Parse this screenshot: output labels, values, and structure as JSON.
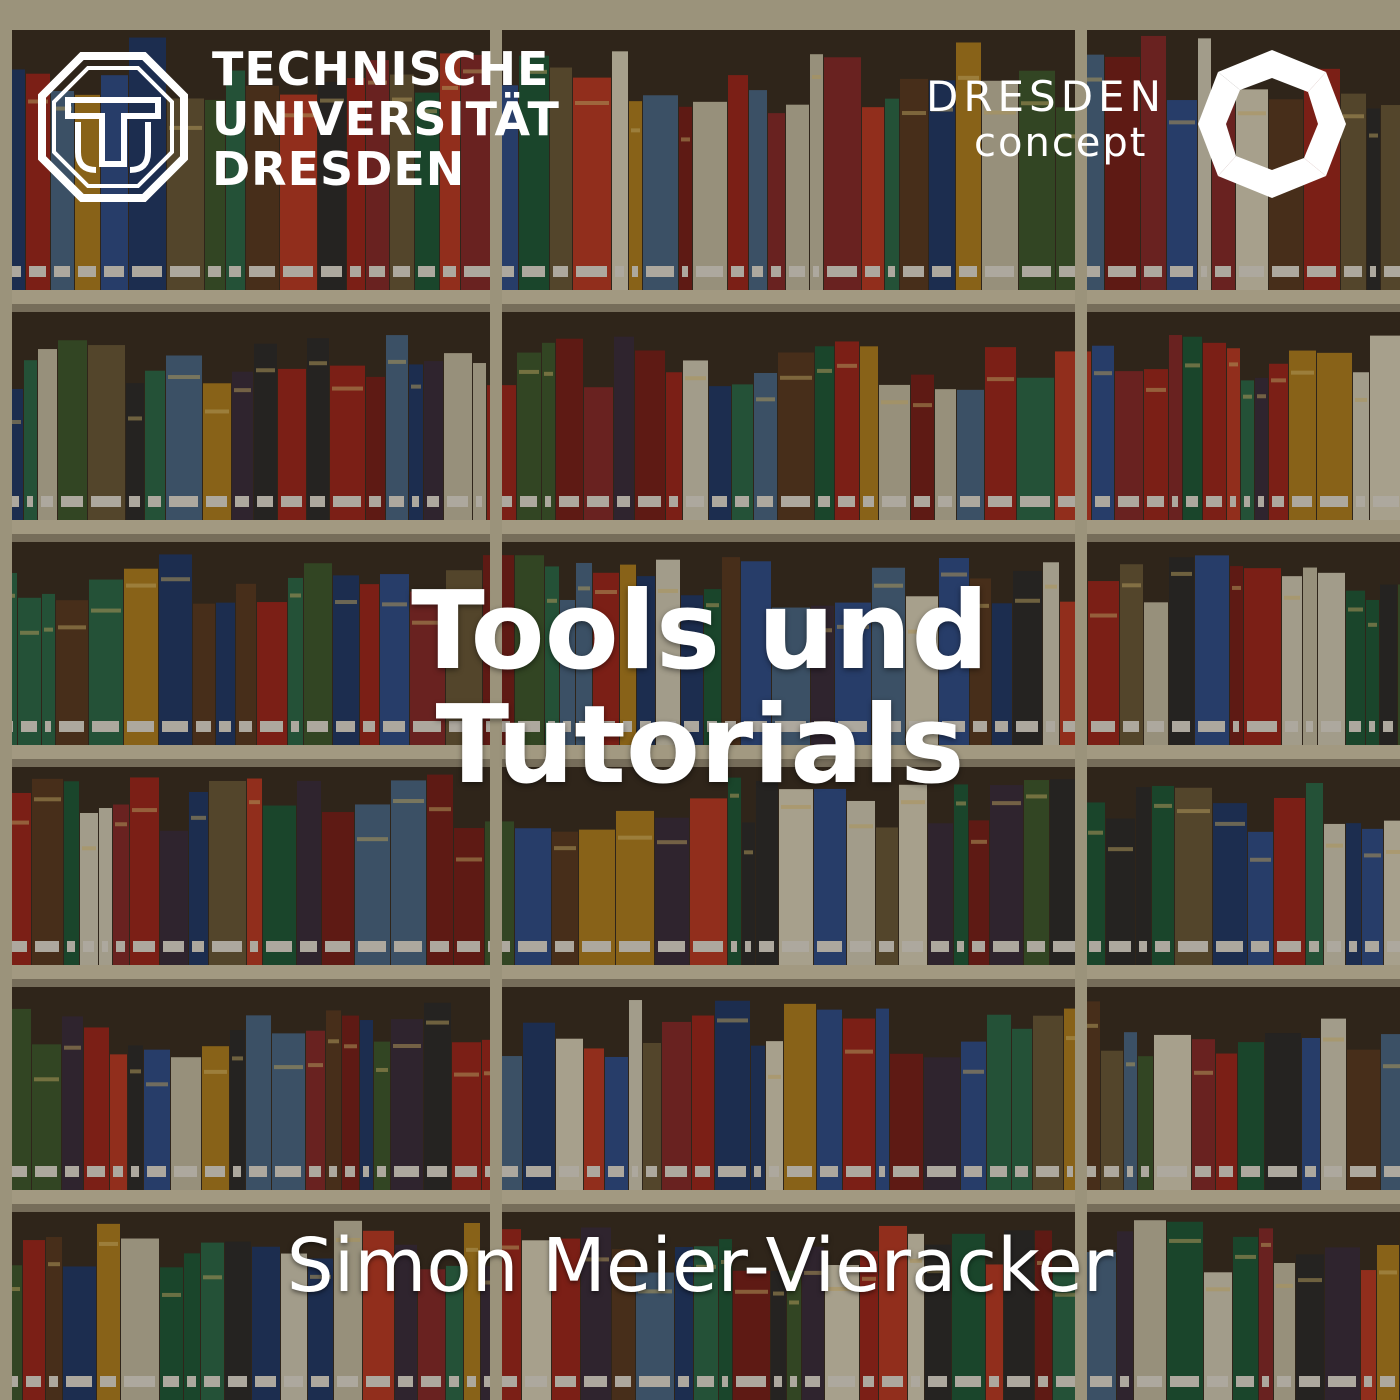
{
  "logos": {
    "left": {
      "icon": "tu-dresden-octagon-icon",
      "lines": [
        "TECHNISCHE",
        "UNIVERSITÄT",
        "DRESDEN"
      ]
    },
    "right": {
      "icon": "dresden-concept-octagon-icon",
      "line1": "DRESDEN",
      "line2": "concept"
    }
  },
  "title": {
    "line1": "Tools und",
    "line2": "Tutorials"
  },
  "author": "Simon Meier-Vieracker",
  "colors": {
    "text": "#ffffff",
    "shelf": "#d8cfb0"
  },
  "background": "library-bookshelves-photo"
}
